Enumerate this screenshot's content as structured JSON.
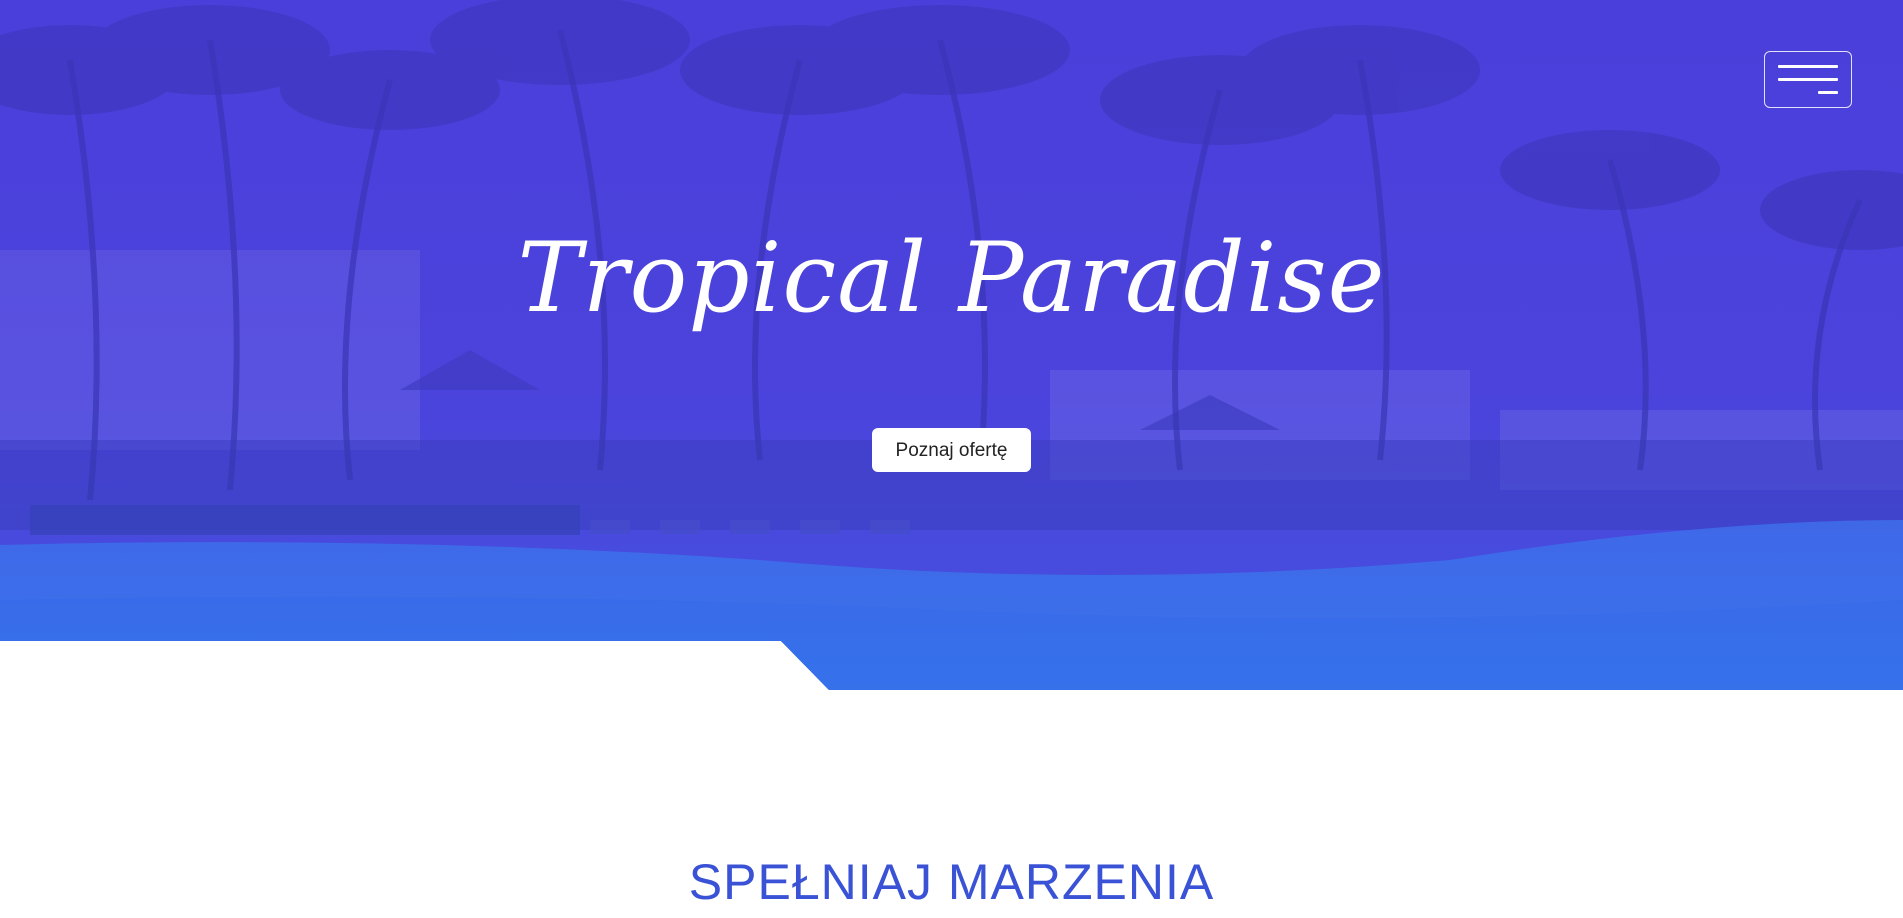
{
  "hero": {
    "title": "Tropical Paradise",
    "cta_label": "Poznaj ofertę",
    "menu_icon": "hamburger-menu-icon",
    "overlay_color": "#4a3fd6",
    "accent_color": "#3a74ea"
  },
  "section": {
    "title": "SPEŁNIAJ MARZENIA",
    "title_color": "#3a52d6"
  }
}
